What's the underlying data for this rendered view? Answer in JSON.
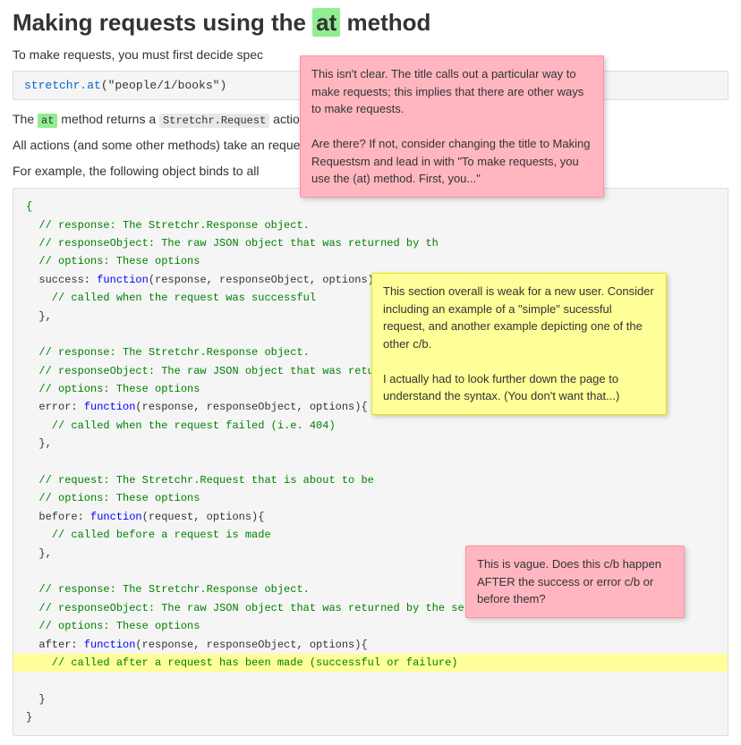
{
  "page": {
    "title_prefix": "Making requests using the ",
    "title_highlight": "at",
    "title_suffix": " method",
    "intro": "To make requests, you must first decide spec",
    "code_example": "stretchr.at(\"people/1/books\")",
    "body_line1_prefix": "The ",
    "body_line1_highlight": "at",
    "body_line1_middle": " method returns a ",
    "body_line1_code": "Stretchr.Request",
    "body_line1_suffix": " action.",
    "body_line2": "All actions (and some other methods) take an",
    "body_line2_suffix": " requests.",
    "body_line3": "For example, the following object binds to all",
    "code_lines": [
      "{",
      "  // response: The Stretchr.Response object.",
      "  // responseObject: The raw JSON object that was returned by th",
      "  // options: These options",
      "  success: function(response, responseObject, options){",
      "    // called when the request was successful",
      "  },",
      "",
      "  // response: The Stretchr.Response object.",
      "  // responseObject: The raw JSON object that was retu",
      "  // options: These options",
      "  error: function(response, responseObject, options){",
      "    // called when the request failed (i.e. 404)",
      "  },",
      "",
      "  // request: The Stretchr.Request that is about to be",
      "  // options: These options",
      "  before: function(request, options){",
      "    // called before a request is made",
      "  },",
      "",
      "  // response: The Stretchr.Response object.",
      "  // responseObject: The raw JSON object that was returned by the serv",
      "  // options: These options",
      "  after: function(response, responseObject, options){",
      "    // called after a request has been made (successful or failure)",
      "  }",
      "}"
    ],
    "annotation1": {
      "text": "This isn't clear. The title calls out a particular way to make requests; this implies that there are other ways to make requests.\n\nAre there? If not, consider changing the title to Making Requestsm and lead in with \"To make requests, you use the (at) method. First, you...\""
    },
    "annotation2": {
      "text": "This section overall is weak for a new user. Consider including an example of a \"simple\" sucessful request, and another example depicting one of the other c/b.\n\nI actually had to look further down the page to understand the syntax. (You don't want that...)"
    },
    "annotation3": {
      "text": "This is vague. Does this c/b happen AFTER the success or error c/b or before them?"
    }
  }
}
